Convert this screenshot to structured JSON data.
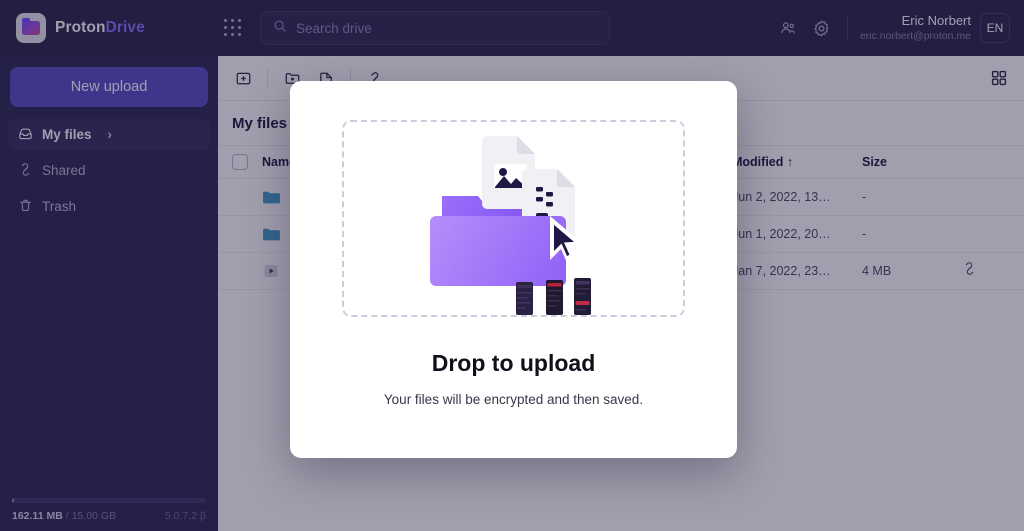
{
  "app": {
    "brand_primary": "Proton",
    "brand_secondary": "Drive",
    "accent_color": "#8a6dff",
    "upload_button_color": "#564bc7",
    "sidebar_color": "#2a2550",
    "topbar_color": "#262248"
  },
  "topbar": {
    "apps_grid_icon": "apps-grid-icon",
    "search": {
      "icon": "search-icon",
      "placeholder": "Search drive",
      "value": ""
    },
    "contacts_icon": "contacts-icon",
    "settings_icon": "gear-icon",
    "user": {
      "name": "Eric Norbert",
      "email": "eric.norbert@proton.me"
    },
    "language": "EN"
  },
  "sidebar": {
    "upload_label": "New upload",
    "items": [
      {
        "label": "My files",
        "icon": "inbox-icon",
        "active": true,
        "chevron": "›"
      },
      {
        "label": "Shared",
        "icon": "link-icon",
        "active": false,
        "chevron": ""
      },
      {
        "label": "Trash",
        "icon": "trash-icon",
        "active": false,
        "chevron": ""
      }
    ],
    "storage": {
      "used": "162.11 MB",
      "separator": "/",
      "total": "15.00 GB",
      "percent": 1,
      "version": "5.0.7.2 β"
    }
  },
  "toolbar": {
    "buttons": [
      {
        "name": "new-folder-icon",
        "title": "New folder"
      },
      {
        "name": "share-folder-icon",
        "title": "Share folder"
      },
      {
        "name": "share-file-icon",
        "title": "Share file"
      },
      {
        "name": "get-link-icon",
        "title": "Get link"
      }
    ],
    "view_toggle_icon": "grid-view-icon"
  },
  "breadcrumb": {
    "current": "My files"
  },
  "table": {
    "columns": {
      "name": "Name",
      "modified": "Modified",
      "sort_arrow": "↑",
      "size": "Size"
    },
    "rows": [
      {
        "icon": "folder-icon",
        "name": "",
        "modified": "Jun 2, 2022, 13…",
        "size": "-",
        "shared_icon": ""
      },
      {
        "icon": "folder-icon",
        "name": "",
        "modified": "Jun 1, 2022, 20…",
        "size": "-",
        "shared_icon": ""
      },
      {
        "icon": "video-icon",
        "name": "",
        "modified": "Jan 7, 2022, 23…",
        "size": "4 MB",
        "shared_icon": "link-icon"
      }
    ]
  },
  "modal": {
    "title": "Drop to upload",
    "subtitle": "Your files will be encrypted and then saved.",
    "illustration": "folder-with-files-and-cursor-illustration"
  }
}
